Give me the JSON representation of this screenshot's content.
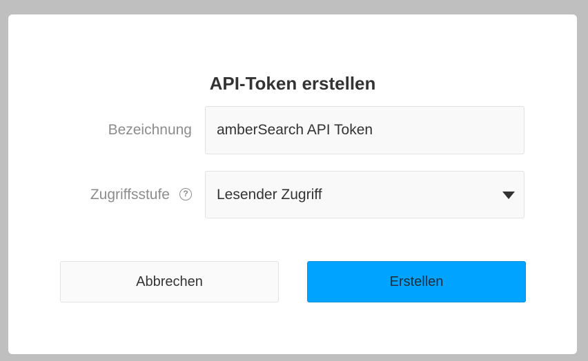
{
  "dialog": {
    "title": "API-Token erstellen"
  },
  "form": {
    "name_label": "Bezeichnung",
    "name_value": "amberSearch API Token",
    "access_label": "Zugriffsstufe",
    "access_help_icon": "question-circle-icon",
    "access_selected": "Lesender Zugriff",
    "access_dropdown_icon": "caret-down-icon"
  },
  "actions": {
    "cancel_label": "Abbrechen",
    "create_label": "Erstellen"
  },
  "colors": {
    "primary": "#00a3ff",
    "overlay": "#bfbfbf",
    "label": "#8c8c8c",
    "text": "#333333"
  }
}
